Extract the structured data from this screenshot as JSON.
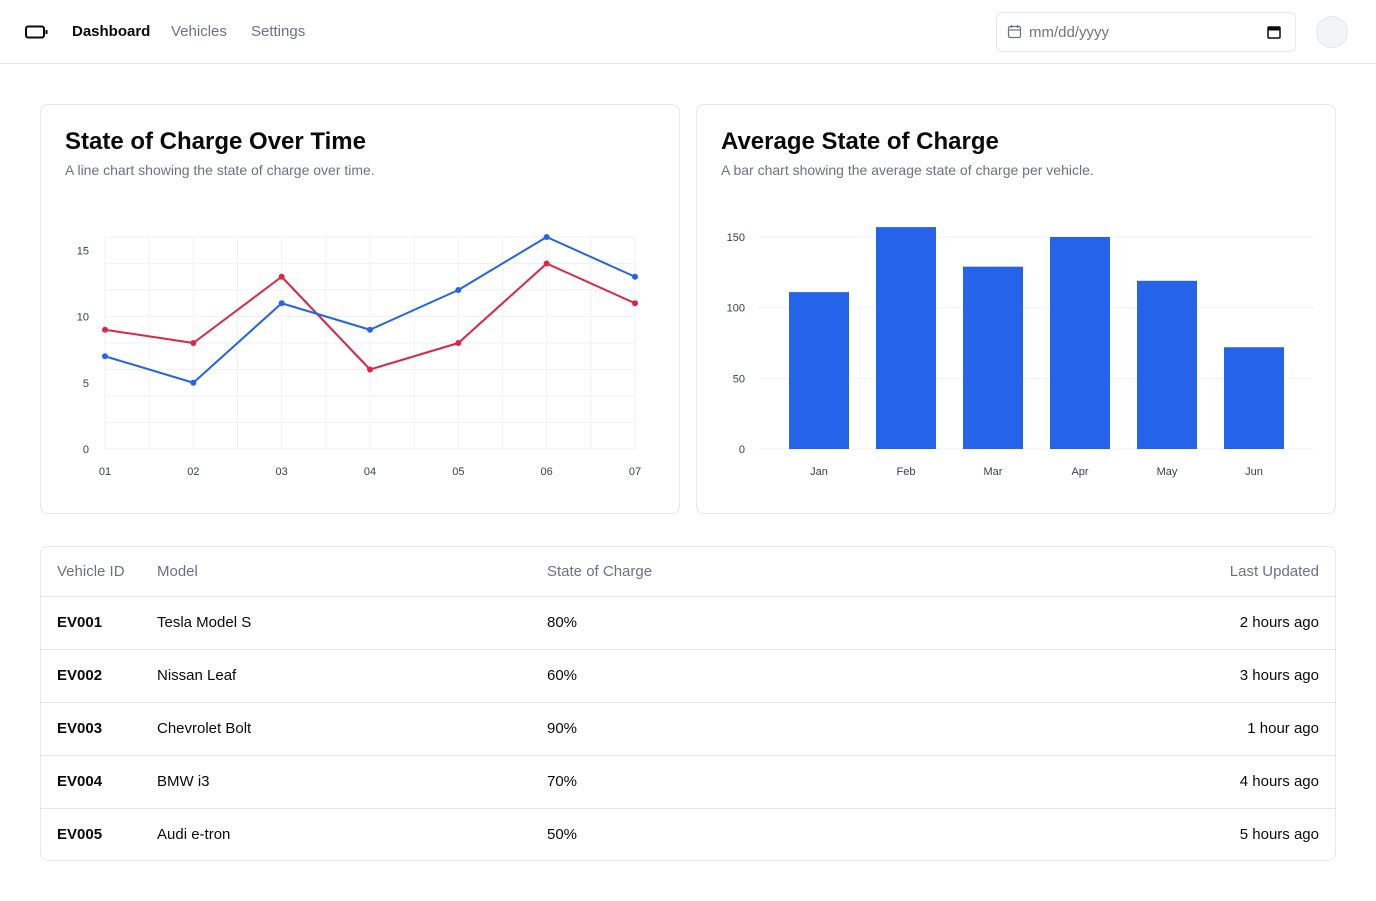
{
  "nav": {
    "logo_icon": "battery-icon",
    "links": [
      "Dashboard",
      "Vehicles",
      "Settings"
    ],
    "active": "Dashboard"
  },
  "date_filter": {
    "placeholder": "mm/dd/yyyy",
    "icon": "calendar-icon"
  },
  "line_card": {
    "title": "State of Charge Over Time",
    "description": "A line chart showing the state of charge over time."
  },
  "bar_card": {
    "title": "Average State of Charge",
    "description": "A bar chart showing the average state of charge per vehicle."
  },
  "chart_data": [
    {
      "type": "line",
      "x": [
        "01",
        "02",
        "03",
        "04",
        "05",
        "06",
        "07"
      ],
      "series": [
        {
          "values": [
            7,
            5,
            11,
            9,
            12,
            16,
            13
          ],
          "color": "#2563eb"
        },
        {
          "values": [
            9,
            8,
            13,
            6,
            8,
            14,
            11
          ],
          "color": "#dc2646"
        }
      ],
      "yticks": [
        0,
        5,
        10,
        15
      ],
      "ylim": [
        0,
        16
      ],
      "grid": true
    },
    {
      "type": "bar",
      "categories": [
        "Jan",
        "Feb",
        "Mar",
        "Apr",
        "May",
        "Jun"
      ],
      "values": [
        111,
        157,
        129,
        150,
        119,
        72
      ],
      "color": "#2563eb",
      "yticks": [
        0,
        50,
        100,
        150
      ],
      "ylim": [
        0,
        150
      ],
      "grid": true
    }
  ],
  "table": {
    "headers": [
      "Vehicle ID",
      "Model",
      "State of Charge",
      "Last Updated"
    ],
    "rows": [
      [
        "EV001",
        "Tesla Model S",
        "80%",
        "2 hours ago"
      ],
      [
        "EV002",
        "Nissan Leaf",
        "60%",
        "3 hours ago"
      ],
      [
        "EV003",
        "Chevrolet Bolt",
        "90%",
        "1 hour ago"
      ],
      [
        "EV004",
        "BMW i3",
        "70%",
        "4 hours ago"
      ],
      [
        "EV005",
        "Audi e-tron",
        "50%",
        "5 hours ago"
      ]
    ]
  },
  "colors": {
    "accent_blue": "#2563eb",
    "accent_red": "#dc2646",
    "border": "#e5e7eb",
    "muted_text": "#6b7280"
  }
}
